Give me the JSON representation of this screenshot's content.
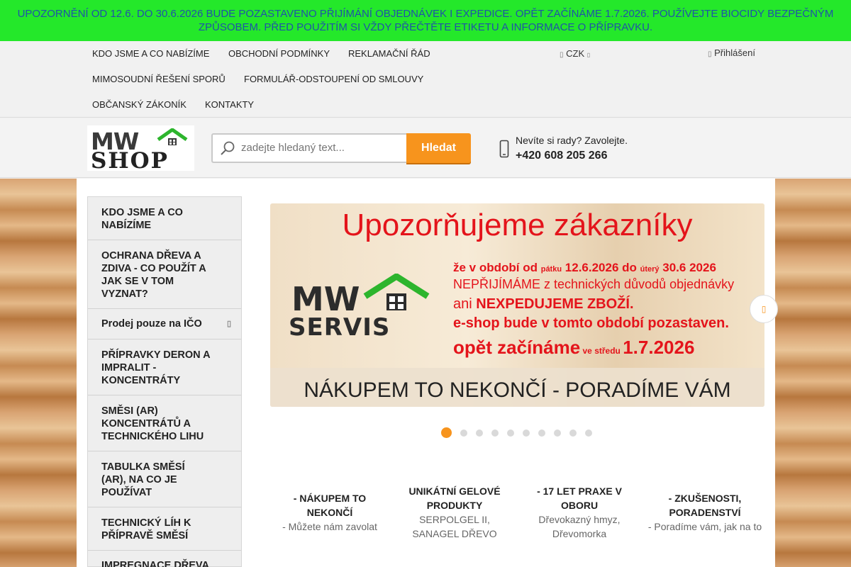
{
  "notice": {
    "line1": "UPOZORNĚNÍ OD 12.6. DO 30.6.2026 BUDE POZASTAVENO PŘIJÍMÁNÍ OBJEDNÁVEK I EXPEDICE. OPĚT ZAČÍNÁME 1.7.2026. POUŽÍVEJTE BIOCIDY BEZPEČNÝM",
    "line2": "ZPŮSOBEM. PŘED POUŽITÍM SI VŽDY PŘEČTĚTE ETIKETU A INFORMACE O PŘÍPRAVKU."
  },
  "topnav": {
    "links": [
      "KDO JSME A CO NABÍZÍME",
      "OBCHODNÍ PODMÍNKY",
      "REKLAMAČNÍ ŘÁD",
      "MIMOSOUDNÍ ŘEŠENÍ SPORŮ",
      "FORMULÁŘ-ODSTOUPENÍ OD SMLOUVY",
      "OBČANSKÝ ZÁKONÍK",
      "KONTAKTY"
    ],
    "currency": "CZK",
    "login": "Přihlášení"
  },
  "header": {
    "logo_top": "MW",
    "logo_bottom": "SHOP",
    "search_placeholder": "zadejte hledaný text...",
    "search_button": "Hledat",
    "help_text": "Nevíte si rady? Zavolejte.",
    "phone": "+420 608 205 266"
  },
  "sidebar": {
    "items": [
      [
        "KDO JSME A CO",
        "NABÍZÍME"
      ],
      [
        "OCHRANA DŘEVA A",
        "ZDIVA - CO POUŽÍT A",
        "JAK SE V TOM",
        "VYZNAT?"
      ],
      [
        "Prodej pouze na IČO"
      ],
      [
        "PŘÍPRAVKY DERON A",
        "IMPRALIT -",
        "KONCENTRÁTY"
      ],
      [
        "SMĚSI (AR)",
        "KONCENTRÁTŮ A",
        "TECHNICKÉHO LIHU"
      ],
      [
        "TABULKA SMĚSÍ",
        "(AR), NA CO JE",
        "POUŽÍVAT"
      ],
      [
        "TECHNICKÝ LÍH K",
        "PŘÍPRAVĚ SMĚSÍ"
      ],
      [
        "IMPREGNACE DŘEVA"
      ]
    ]
  },
  "banner": {
    "headline": "Upozorňujeme zákazníky",
    "l1_a": "že v období od ",
    "l1_b": "pátku",
    "l1_c": " 12.6.2026 do ",
    "l1_d": "úterý",
    "l1_e": " 30.6 2026",
    "l2": "NEPŘIJÍMÁME z technických důvodů objednávky",
    "l3_a": "ani ",
    "l3_b": "NEXPEDUJEME ZBOŽÍ.",
    "l4": "e-shop bude v tomto období pozastaven.",
    "l5_a": "opět začínáme",
    "l5_b": " ve středu ",
    "l5_c": "1.7.2026",
    "logo_top": "MW",
    "logo_bottom": "SERVIS",
    "bottom": "NÁKUPEM TO NEKONČÍ - PORADÍME VÁM",
    "next_icon": "chevron-right-icon",
    "slides_count": 10,
    "active_slide": 1
  },
  "features": [
    {
      "title1": "- NÁKUPEM TO",
      "title2": "NEKONČÍ",
      "desc1": "- Můžete nám zavolat",
      "desc2": ""
    },
    {
      "title1": "UNIKÁTNÍ GELOVÉ",
      "title2": "PRODUKTY",
      "desc1": "SERPOLGEL II,",
      "desc2": "SANAGEL DŘEVO"
    },
    {
      "title1": "- 17 LET PRAXE V",
      "title2": "OBORU",
      "desc1": "Dřevokazný hmyz,",
      "desc2": "Dřevomorka"
    },
    {
      "title1": "- ZKUŠENOSTI,",
      "title2": "PORADENSTVÍ",
      "desc1": "- Poradíme vám, jak na to",
      "desc2": ""
    }
  ],
  "colors": {
    "notice_bg": "#24e82a",
    "notice_text": "#1f53a8",
    "accent": "#f7941d",
    "banner_red": "#e4141b"
  }
}
